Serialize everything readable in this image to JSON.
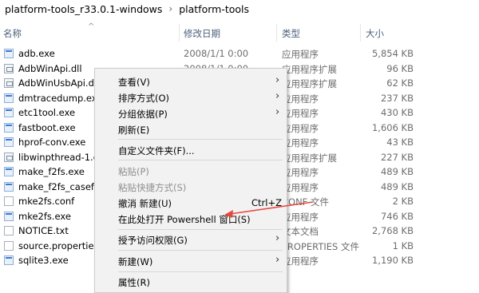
{
  "breadcrumb": {
    "parent": "platform-tools_r33.0.1-windows",
    "separator": "›",
    "current": "platform-tools"
  },
  "columns": {
    "name": "名称",
    "sort_caret": "^",
    "date": "修改日期",
    "type": "类型",
    "size": "大小"
  },
  "files": [
    {
      "name": "adb.exe",
      "date": "2008/1/1 0:00",
      "type": "应用程序",
      "size": "5,854 KB",
      "icon": "exe"
    },
    {
      "name": "AdbWinApi.dll",
      "date": "2008/1/1 0:00",
      "type": "应用程序扩展",
      "size": "96 KB",
      "icon": "dll"
    },
    {
      "name": "AdbWinUsbApi.dll",
      "date": "",
      "type": "应用程序扩展",
      "size": "62 KB",
      "icon": "dll"
    },
    {
      "name": "dmtracedump.exe",
      "date": "",
      "type": "应用程序",
      "size": "237 KB",
      "icon": "exe"
    },
    {
      "name": "etc1tool.exe",
      "date": "",
      "type": "应用程序",
      "size": "430 KB",
      "icon": "exe"
    },
    {
      "name": "fastboot.exe",
      "date": "",
      "type": "应用程序",
      "size": "1,606 KB",
      "icon": "exe"
    },
    {
      "name": "hprof-conv.exe",
      "date": "",
      "type": "应用程序",
      "size": "43 KB",
      "icon": "exe"
    },
    {
      "name": "libwinpthread-1.dll",
      "date": "",
      "type": "应用程序扩展",
      "size": "227 KB",
      "icon": "dll"
    },
    {
      "name": "make_f2fs.exe",
      "date": "",
      "type": "应用程序",
      "size": "489 KB",
      "icon": "exe"
    },
    {
      "name": "make_f2fs_casefold",
      "date": "",
      "type": "应用程序",
      "size": "489 KB",
      "icon": "exe"
    },
    {
      "name": "mke2fs.conf",
      "date": "",
      "type": "CONF 文件",
      "size": "2 KB",
      "icon": "doc"
    },
    {
      "name": "mke2fs.exe",
      "date": "",
      "type": "应用程序",
      "size": "746 KB",
      "icon": "exe"
    },
    {
      "name": "NOTICE.txt",
      "date": "",
      "type": "文本文档",
      "size": "2,768 KB",
      "icon": "doc"
    },
    {
      "name": "source.properties",
      "date": "",
      "type": "PROPERTIES 文件",
      "size": "1 KB",
      "icon": "doc"
    },
    {
      "name": "sqlite3.exe",
      "date": "",
      "type": "应用程序",
      "size": "1,190 KB",
      "icon": "exe"
    }
  ],
  "context_menu": {
    "view": "查看(V)",
    "sort_by": "排序方式(O)",
    "group_by": "分组依据(P)",
    "refresh": "刷新(E)",
    "customize_folder": "自定义文件夹(F)...",
    "paste": "粘贴(P)",
    "paste_shortcut": "粘贴快捷方式(S)",
    "undo_new": "撤消 新建(U)",
    "undo_shortcut": "Ctrl+Z",
    "open_powershell": "在此处打开 Powershell 窗口(S)",
    "grant_access": "授予访问权限(G)",
    "new": "新建(W)",
    "properties": "属性(R)",
    "submenu_arrow": "›"
  },
  "colors": {
    "menu_bg": "#f2f2f2",
    "annotation": "#e8453c",
    "header_text": "#4c607a"
  }
}
